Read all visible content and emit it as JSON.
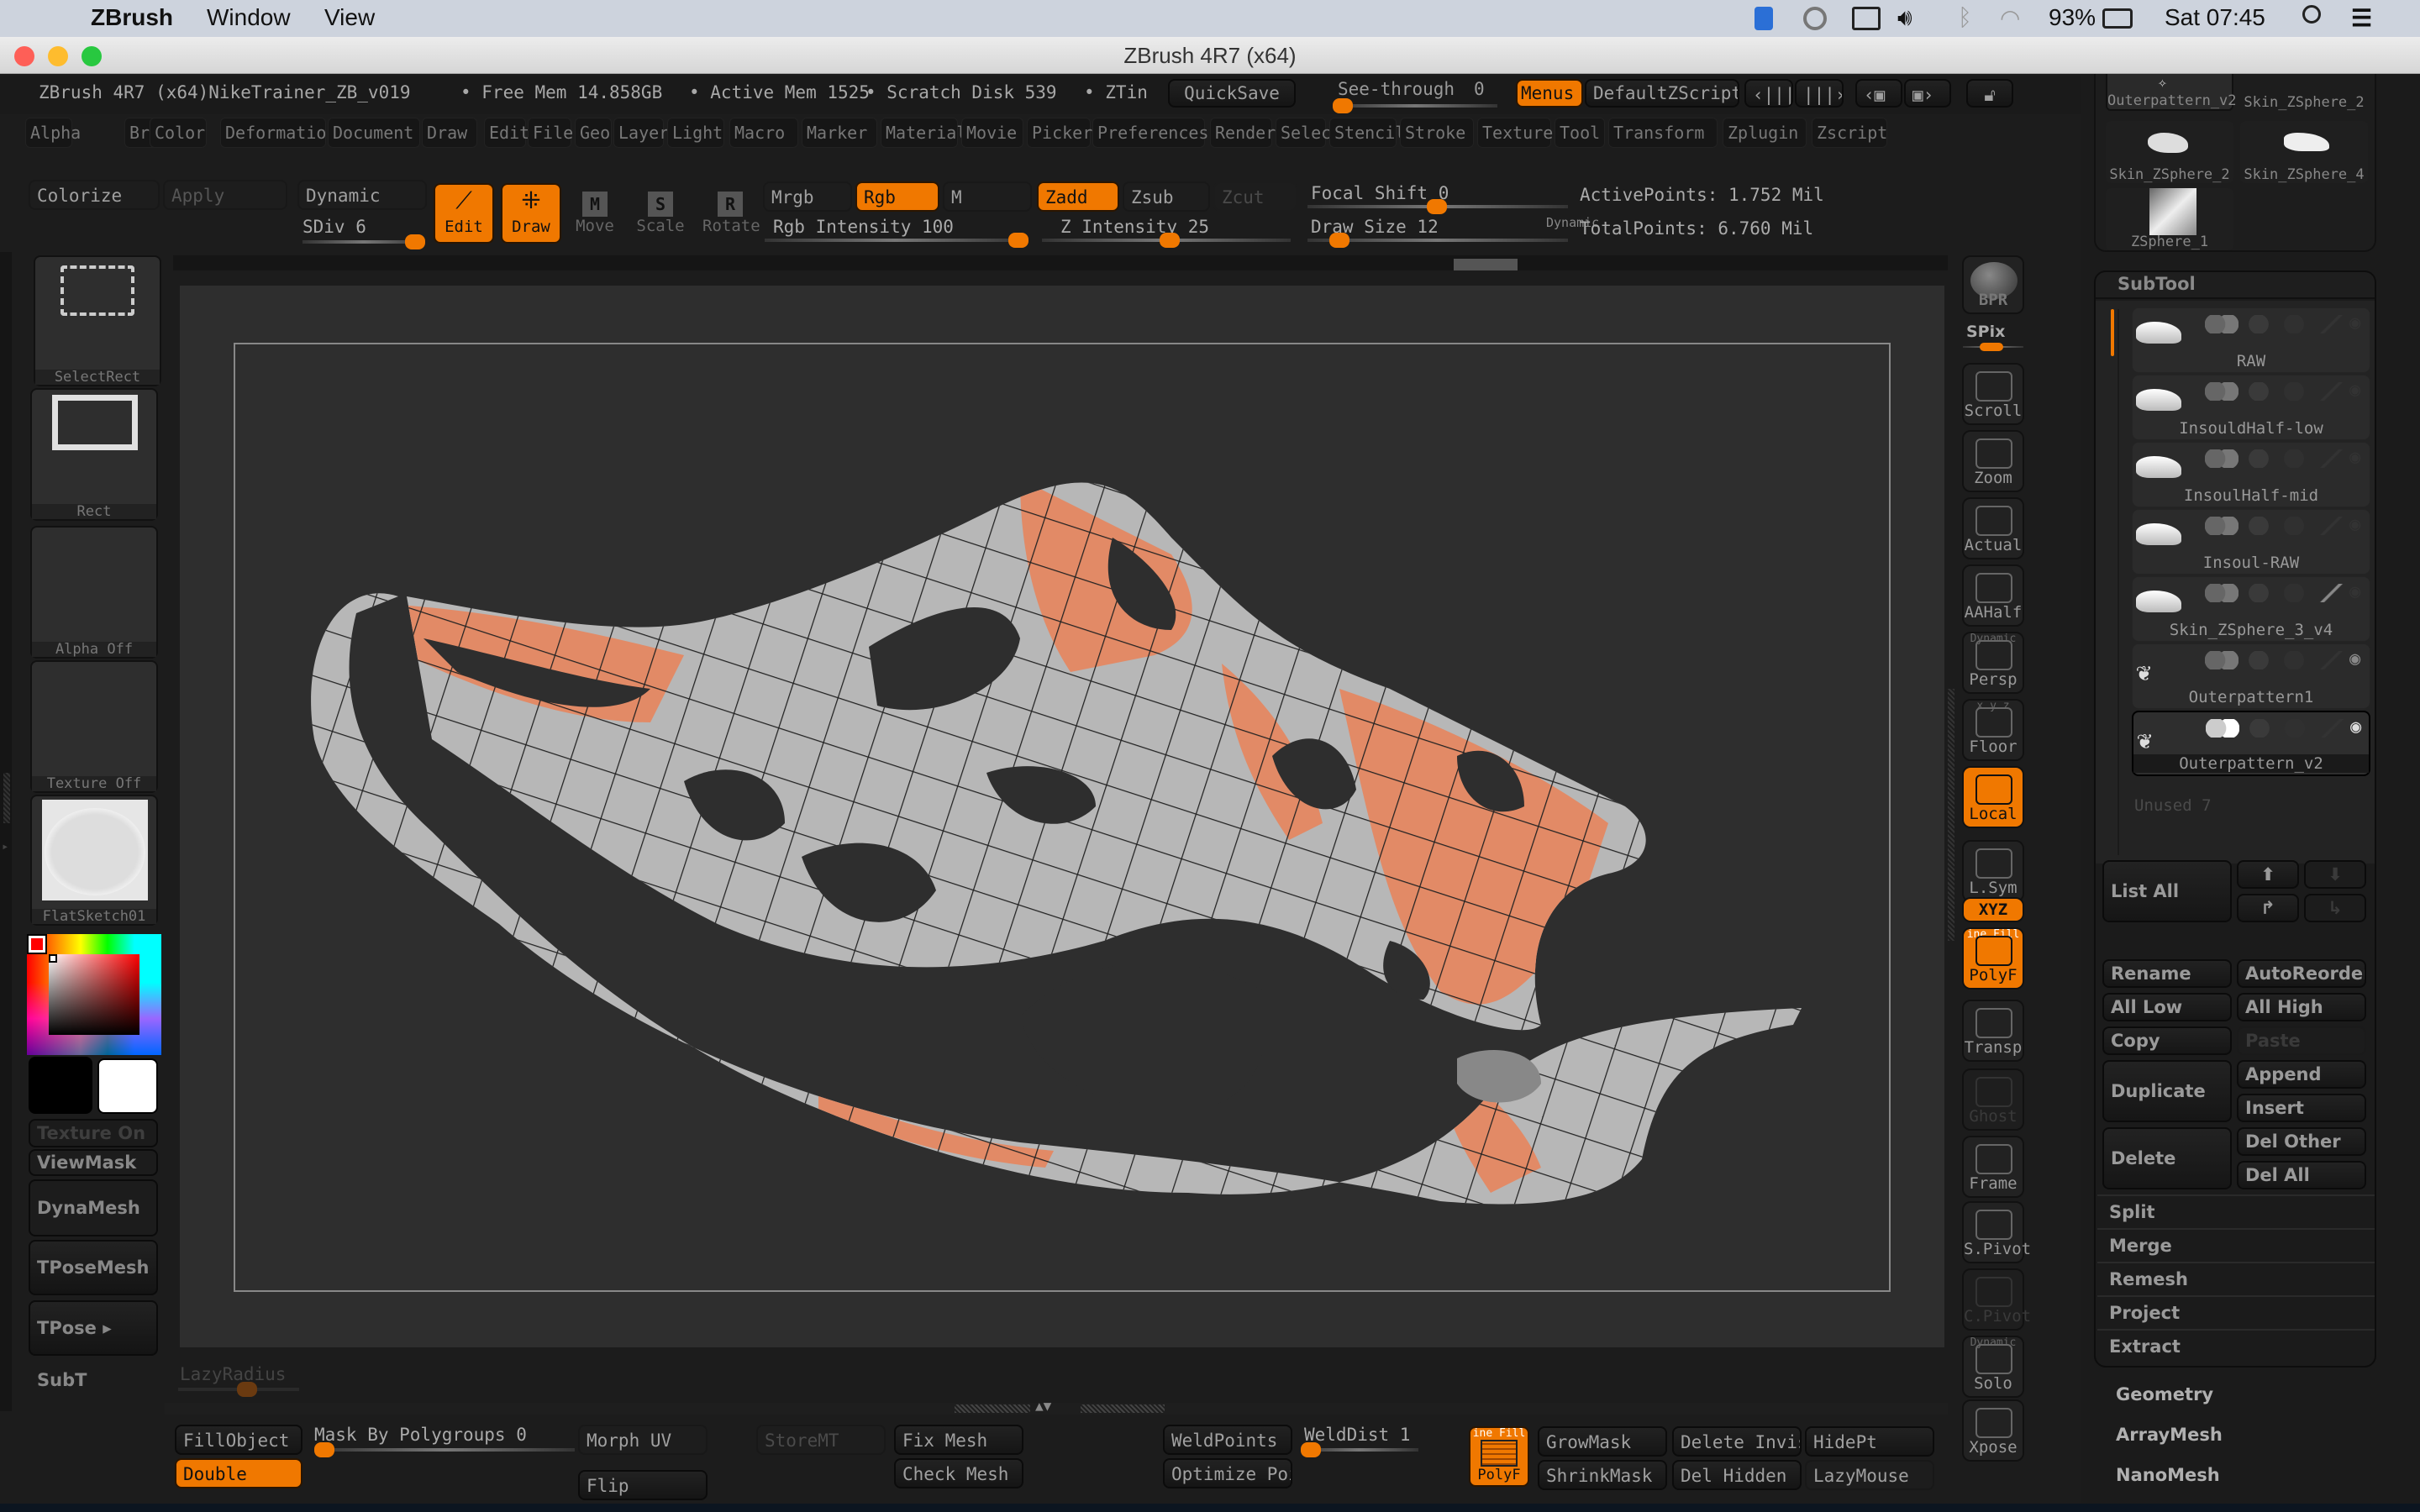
{
  "mac_menubar": {
    "app_name": "ZBrush",
    "menus": [
      "Window",
      "View"
    ],
    "battery": "93%",
    "clock": "Sat 07:45"
  },
  "window": {
    "title": "ZBrush 4R7 (x64)"
  },
  "infobar": {
    "doc_title": "ZBrush 4R7 (x64)NikeTrainer_ZB_v019",
    "free_mem": "• Free Mem 14.858GB",
    "active_mem": "• Active Mem 1525",
    "scratch_disk": "• Scratch Disk 539",
    "ztime": "• ZTin",
    "quicksave": "QuickSave",
    "see_through_label": "See-through",
    "see_through_value": "0",
    "menus_button": "Menus",
    "default_zscript": "DefaultZScript"
  },
  "main_menu": [
    "Alpha",
    "Brush",
    "Color",
    "Deformation",
    "Document",
    "Draw",
    "Edit",
    "File",
    "Geo",
    "Layer",
    "Light",
    "Macro",
    "Marker",
    "Material",
    "Movie",
    "Picker",
    "Preferences",
    "Render",
    "Select",
    "Stencil",
    "Stroke",
    "Texture",
    "Tool",
    "Transform",
    "Zplugin",
    "Zscript"
  ],
  "toolbar": {
    "colorize": "Colorize",
    "apply": "Apply",
    "dynamic": "Dynamic",
    "sdiv_label": "SDiv 6",
    "sdiv_value": 6,
    "edit": "Edit",
    "draw": "Draw",
    "move": "Move",
    "scale": "Scale",
    "rotate": "Rotate",
    "mrgb": "Mrgb",
    "rgb": "Rgb",
    "m": "M",
    "zadd": "Zadd",
    "zsub": "Zsub",
    "zcut": "Zcut",
    "rgb_intensity_label": "Rgb Intensity 100",
    "rgb_intensity": 100,
    "z_intensity_label": "Z Intensity 25",
    "z_intensity": 25,
    "focal_shift_label": "Focal Shift 0",
    "focal_shift": 0,
    "draw_size_label": "Draw Size 12",
    "draw_size": 12,
    "draw_size_dynamic": "Dynamic",
    "active_points": "ActivePoints: 1.752 Mil",
    "total_points": "TotalPoints: 6.760 Mil"
  },
  "left_shelf": {
    "brush_thumbs": [
      {
        "label": "SelectRect"
      },
      {
        "label": "Rect"
      },
      {
        "label": "Alpha Off"
      },
      {
        "label": "Texture Off"
      },
      {
        "label": "FlatSketch01"
      }
    ],
    "primary_color": "#ff0000",
    "main_swatch": "#000000",
    "secondary_swatch": "#ffffff",
    "texture_on": "Texture On",
    "viewmask": "ViewMask",
    "dynamesh": "DynaMesh",
    "tposemesh": "TPoseMesh",
    "tpose_subt": "TPose ▸ SubT"
  },
  "right_shelf": {
    "bpr": "BPR",
    "spix": "SPix",
    "buttons": [
      {
        "label": "Scroll",
        "icon": "hand-icon"
      },
      {
        "label": "Zoom",
        "icon": "magnifier-icon"
      },
      {
        "label": "Actual",
        "icon": "actual-size-icon"
      },
      {
        "label": "AAHalf",
        "icon": "aa-half-icon"
      },
      {
        "label": "Persp",
        "icon": "perspective-icon",
        "top_label": "Dynamic"
      },
      {
        "label": "Floor",
        "icon": "floor-icon",
        "top_label": "x y z"
      },
      {
        "label": "Local",
        "icon": "local-icon",
        "active": true
      },
      {
        "label": "L.Sym",
        "icon": "local-symmetry-icon"
      },
      {
        "label": "XYZ",
        "icon": "rotate-xyz-icon",
        "active": true
      },
      {
        "label": "PolyF",
        "icon": "polyframe-icon",
        "active": true,
        "top_label": "ine Fill"
      },
      {
        "label": "Transp",
        "icon": "transparency-icon"
      },
      {
        "label": "Ghost",
        "icon": "ghost-icon",
        "disabled": true
      },
      {
        "label": "Frame",
        "icon": "frame-icon"
      },
      {
        "label": "S.Pivot",
        "icon": "set-pivot-icon"
      },
      {
        "label": "C.Pivot",
        "icon": "clear-pivot-icon",
        "disabled": true
      },
      {
        "label": "Solo",
        "icon": "solo-icon",
        "top_label": "Dynamic"
      },
      {
        "label": "Xpose",
        "icon": "xpose-icon"
      }
    ]
  },
  "tool_palette": {
    "thumbs": [
      {
        "label": "Outerpattern_v2",
        "selected": true
      },
      {
        "label": "Skin_ZSphere_2"
      },
      {
        "label": "Skin_ZSphere_2"
      },
      {
        "label": "Skin_ZSphere_4"
      },
      {
        "label": "ZSphere_1"
      }
    ]
  },
  "subtool": {
    "title": "SubTool",
    "items": [
      {
        "name": "RAW",
        "visible": false
      },
      {
        "name": "InsouldHalf-low",
        "visible": false
      },
      {
        "name": "InsoulHalf-mid",
        "visible": false
      },
      {
        "name": "Insoul-RAW",
        "visible": false
      },
      {
        "name": "Skin_ZSphere_3_v4",
        "visible": false
      },
      {
        "name": "Outerpattern1",
        "visible": true
      },
      {
        "name": "Outerpattern_v2",
        "visible": true,
        "selected": true
      }
    ],
    "unused": "Unused  7",
    "list_all": "List All",
    "rename": "Rename",
    "autoreorder": "AutoReorder",
    "all_low": "All Low",
    "all_high": "All High",
    "copy": "Copy",
    "paste": "Paste",
    "duplicate": "Duplicate",
    "append": "Append",
    "insert": "Insert",
    "delete": "Delete",
    "del_other": "Del Other",
    "del_all": "Del All",
    "sections": [
      "Split",
      "Merge",
      "Remesh",
      "Project",
      "Extract"
    ]
  },
  "tool_sections": [
    "Geometry",
    "ArrayMesh",
    "NanoMesh"
  ],
  "bottom_shelf": {
    "lazy_radius": "LazyRadius",
    "fill_object": "FillObject",
    "double": "Double",
    "mask_by_polygroups_label": "Mask By Polygroups 0",
    "mask_by_polygroups": 0,
    "morph_uv": "Morph UV",
    "flip": "Flip",
    "store_mt": "StoreMT",
    "fix_mesh": "Fix Mesh",
    "check_mesh": "Check Mesh",
    "weld_points": "WeldPoints",
    "weld_dist_label": "WeldDist 1",
    "weld_dist": 1,
    "optimize_points": "Optimize Poi",
    "polyf_top": "ine Fill",
    "polyf": "PolyF",
    "grow_mask": "GrowMask",
    "shrink_mask": "ShrinkMask",
    "delete_invis": "Delete Invis",
    "del_hidden": "Del Hidden",
    "hide_pt": "HidePt",
    "lazy_mouse": "LazyMouse"
  },
  "colors": {
    "accent": "#f07800",
    "mesh_gray": "#b4b4b4",
    "polypaint": "#e08a66",
    "canvas": "#2e2e2e"
  }
}
